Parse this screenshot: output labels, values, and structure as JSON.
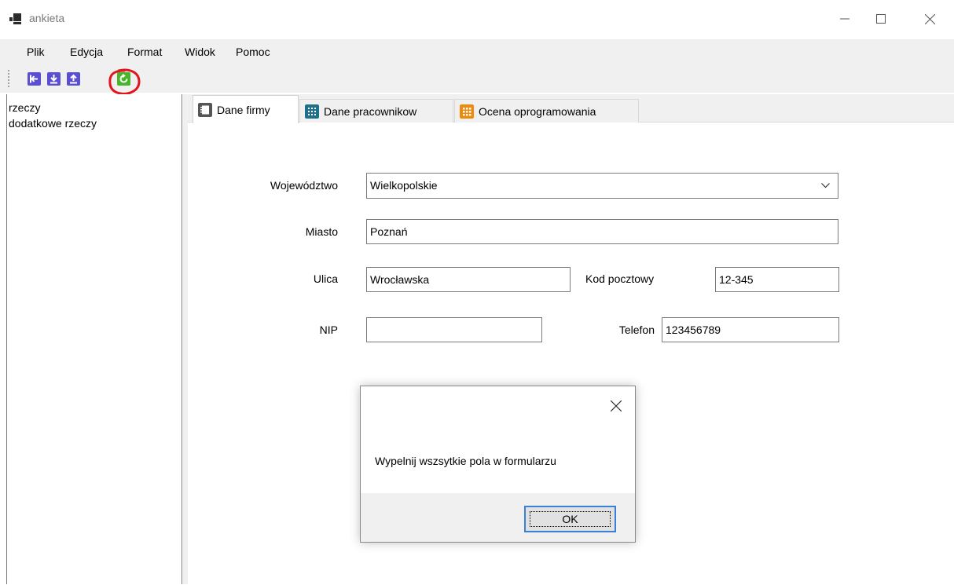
{
  "window": {
    "title": "ankieta",
    "minimize_glyph": "—",
    "maximize_glyph": "☐",
    "close_glyph": "✕"
  },
  "menu": [
    "Plik",
    "Edycja",
    "Format",
    "Widok",
    "Pomoc"
  ],
  "toolbar": {
    "buttons": [
      "exit-icon",
      "download-icon",
      "upload-icon",
      "refresh-icon"
    ],
    "accent": "#5b4fd1",
    "highlight_color": "#e0161d",
    "refresh_color": "#49b52b"
  },
  "left_panel": {
    "items": [
      "rzeczy",
      "dodatkowe rzeczy"
    ]
  },
  "tabs": [
    {
      "label": "Dane firmy",
      "icon": "notebook-icon",
      "active": true
    },
    {
      "label": "Dane pracownikow",
      "icon": "grid-icon",
      "active": false
    },
    {
      "label": "Ocena oprogramowania",
      "icon": "calculator-icon",
      "active": false
    }
  ],
  "form": {
    "wojewodztwo_label": "Województwo",
    "wojewodztwo_value": "Wielkopolskie",
    "miasto_label": "Miasto",
    "miasto_value": "Poznań",
    "ulica_label": "Ulica",
    "ulica_value": "Wrocławska",
    "kod_label": "Kod pocztowy",
    "kod_value": "12-345",
    "nip_label": "NIP",
    "nip_value": "",
    "telefon_label": "Telefon",
    "telefon_value": "123456789"
  },
  "dialog": {
    "message": "Wypelnij wszsytkie pola w formularzu",
    "ok_label": "OK",
    "close_glyph": "✕"
  }
}
